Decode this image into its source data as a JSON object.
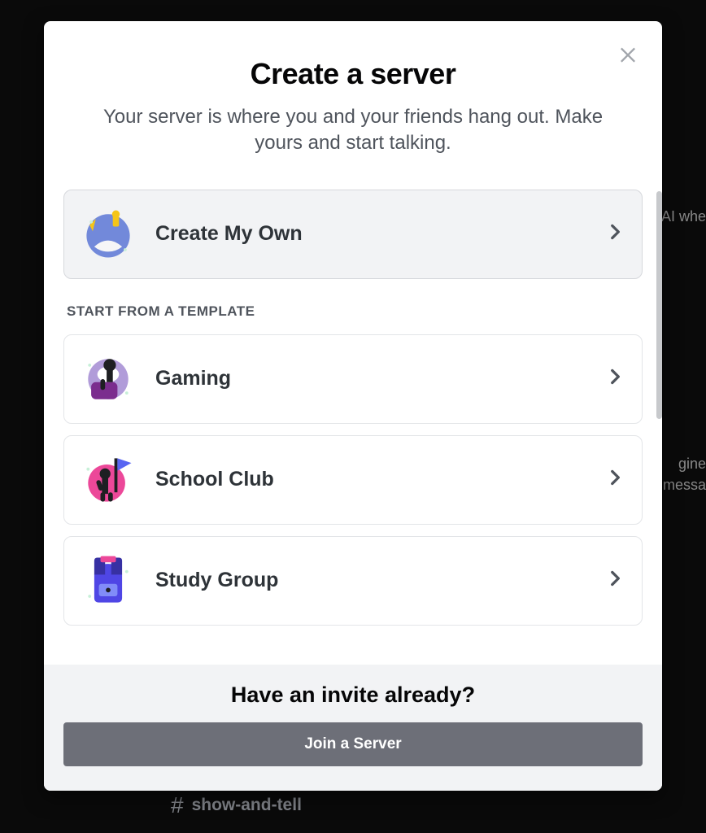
{
  "background": {
    "frag1": "AI whe",
    "frag2": "gine",
    "frag3": "t messa",
    "channel_name": "show-and-tell"
  },
  "modal": {
    "title": "Create a server",
    "subtitle": "Your server is where you and your friends hang out. Make yours and start talking.",
    "featured": {
      "label": "Create My Own"
    },
    "template_header": "START FROM A TEMPLATE",
    "templates": [
      {
        "label": "Gaming"
      },
      {
        "label": "School Club"
      },
      {
        "label": "Study Group"
      }
    ],
    "footer": {
      "title": "Have an invite already?",
      "button": "Join a Server"
    }
  }
}
